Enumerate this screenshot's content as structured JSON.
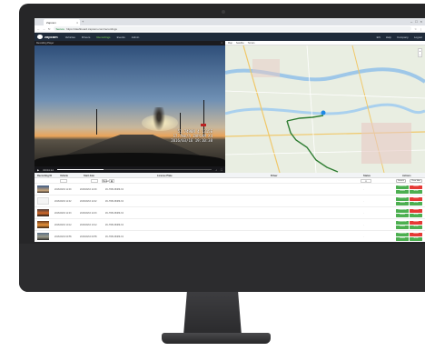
{
  "browser": {
    "tab_title": "Zapcam",
    "url": "https://dashboard.zapcam.com/recordings",
    "secure_label": "Secure"
  },
  "app": {
    "brand": "zapcam",
    "nav": [
      "Vehicles",
      "Drivers",
      "Recordings",
      "Events",
      "Admin"
    ],
    "active_nav_index": 2,
    "right_links": [
      "EN",
      "Help",
      "Company",
      "Logout"
    ]
  },
  "video": {
    "panel_title": "Recording Player",
    "overlay_lines": [
      "51.7496N  4.1315E",
      "17.7km/h  ZAPCAM X4",
      "2016/03/16 19:10:38"
    ],
    "elapsed": "00:04:12",
    "progress": 0.3
  },
  "map": {
    "toolbar": [
      "Map",
      "Satellite",
      "Terrain"
    ]
  },
  "table": {
    "headers": [
      "Recording ID",
      "Vehicle",
      "Start date",
      "License Plate",
      "Driver",
      "Status",
      "Actions"
    ],
    "filter_reset": "Reset",
    "filter_buttons": [
      "Search",
      "Clear filter"
    ],
    "rows": [
      {
        "id": "2016/03/16 11:09",
        "date": "2016/03/16 11:09",
        "plate": "ZC-TDB-36389-X4",
        "thumb": "dusk"
      },
      {
        "id": "2016/03/16 11:02",
        "date": "2016/03/16 11:02",
        "plate": "ZC-TDB-36389-X4",
        "thumb": "white"
      },
      {
        "id": "2016/03/16 11:03",
        "date": "2016/03/16 11:03",
        "plate": "ZC-TDB-36389-X4",
        "thumb": "sunset"
      },
      {
        "id": "2016/03/16 10:12",
        "date": "2016/03/16 10:12",
        "plate": "ZC-TDB-36389-X4",
        "thumb": "orange"
      },
      {
        "id": "2016/03/16 09:55",
        "date": "2016/03/16 09:55",
        "plate": "ZC-TDB-36389-X4",
        "thumb": "road"
      }
    ],
    "action_labels": [
      "Download",
      "Delete",
      "Details",
      "Share"
    ]
  }
}
